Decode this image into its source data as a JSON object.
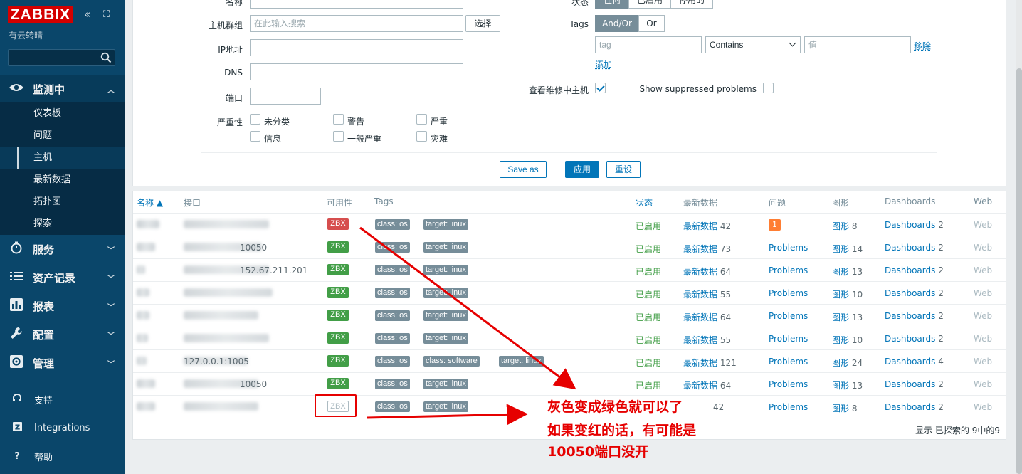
{
  "sidebar": {
    "logo": "ZABBIX",
    "collapse_icon": "«",
    "expand_icon": "⛶",
    "server_name": "有云转晴",
    "menu": [
      {
        "label": "监测中",
        "icon": "eye-icon"
      },
      {
        "label": "服务",
        "icon": "clock-icon"
      },
      {
        "label": "资产记录",
        "icon": "list-icon"
      },
      {
        "label": "报表",
        "icon": "chart-icon"
      },
      {
        "label": "配置",
        "icon": "wrench-icon"
      },
      {
        "label": "管理",
        "icon": "gear-icon"
      }
    ],
    "submenu": [
      "仪表板",
      "问题",
      "主机",
      "最新数据",
      "拓扑图",
      "探索"
    ],
    "bottom": [
      {
        "label": "支持",
        "icon": "headset-icon"
      },
      {
        "label": "Integrations",
        "icon": "integrations-icon"
      },
      {
        "label": "帮助",
        "icon": "help-icon"
      }
    ]
  },
  "filter": {
    "name_label": "名称",
    "group_label": "主机群组",
    "group_placeholder": "在此输入搜索",
    "select_button": "选择",
    "ip_label": "IP地址",
    "dns_label": "DNS",
    "port_label": "端口",
    "severity_label": "严重性",
    "severities": [
      "未分类",
      "警告",
      "严重",
      "信息",
      "一般严重",
      "灾难"
    ],
    "status_label": "状态",
    "status_options": [
      "任何",
      "已启用",
      "停用的"
    ],
    "tags_label": "Tags",
    "tags_and_or": "And/Or",
    "tags_or": "Or",
    "tag_placeholder": "tag",
    "tag_operator": "Contains",
    "tag_value_placeholder": "值",
    "remove_link": "移除",
    "add_link": "添加",
    "maintenance_label": "查看维修中主机",
    "suppressed_label": "Show suppressed problems",
    "save_as": "Save as",
    "apply": "应用",
    "reset": "重设"
  },
  "table": {
    "headers": {
      "name": "名称 ▲",
      "interface": "接口",
      "availability": "可用性",
      "tags": "Tags",
      "status": "状态",
      "latest": "最新数据",
      "problems": "问题",
      "graphs": "图形",
      "dashboards": "Dashboards",
      "web": "Web"
    },
    "rows": [
      {
        "avail": "ZBX",
        "avail_color": "red",
        "tags": [
          "class: os",
          "target: linux"
        ],
        "status": "已启用",
        "latest_label": "最新数据",
        "latest_count": "42",
        "problem": "1",
        "graph_label": "图形",
        "graph_count": "8",
        "dash_label": "Dashboards",
        "dash_count": "2",
        "web": "Web",
        "interface_text": ""
      },
      {
        "avail": "ZBX",
        "avail_color": "green",
        "tags": [
          "class: os",
          "target: linux"
        ],
        "status": "已启用",
        "latest_label": "最新数据",
        "latest_count": "73",
        "problem": "Problems",
        "graph_label": "图形",
        "graph_count": "14",
        "dash_label": "Dashboards",
        "dash_count": "2",
        "web": "Web",
        "interface_text": "10050"
      },
      {
        "avail": "ZBX",
        "avail_color": "green",
        "tags": [
          "class: os",
          "target: linux"
        ],
        "status": "已启用",
        "latest_label": "最新数据",
        "latest_count": "64",
        "problem": "Problems",
        "graph_label": "图形",
        "graph_count": "13",
        "dash_label": "Dashboards",
        "dash_count": "2",
        "web": "Web",
        "interface_text": "152.67.211.201"
      },
      {
        "avail": "ZBX",
        "avail_color": "green",
        "tags": [
          "class: os",
          "target: linux"
        ],
        "status": "已启用",
        "latest_label": "最新数据",
        "latest_count": "55",
        "problem": "Problems",
        "graph_label": "图形",
        "graph_count": "10",
        "dash_label": "Dashboards",
        "dash_count": "2",
        "web": "Web",
        "interface_text": ""
      },
      {
        "avail": "ZBX",
        "avail_color": "green",
        "tags": [
          "class: os",
          "target: linux"
        ],
        "status": "已启用",
        "latest_label": "最新数据",
        "latest_count": "64",
        "problem": "Problems",
        "graph_label": "图形",
        "graph_count": "13",
        "dash_label": "Dashboards",
        "dash_count": "2",
        "web": "Web",
        "interface_text": ""
      },
      {
        "avail": "ZBX",
        "avail_color": "green",
        "tags": [
          "class: os",
          "target: linux"
        ],
        "status": "已启用",
        "latest_label": "最新数据",
        "latest_count": "55",
        "problem": "Problems",
        "graph_label": "图形",
        "graph_count": "10",
        "dash_label": "Dashboards",
        "dash_count": "2",
        "web": "Web",
        "interface_text": ""
      },
      {
        "avail": "ZBX",
        "avail_color": "green",
        "tags": [
          "class: os",
          "class: software",
          "target: linux"
        ],
        "status": "已启用",
        "latest_label": "最新数据",
        "latest_count": "121",
        "problem": "Problems",
        "graph_label": "图形",
        "graph_count": "24",
        "dash_label": "Dashboards",
        "dash_count": "4",
        "web": "Web",
        "interface_text": "127.0.0.1:1005"
      },
      {
        "avail": "ZBX",
        "avail_color": "green",
        "tags": [
          "class: os",
          "target: linux"
        ],
        "status": "已启用",
        "latest_label": "最新数据",
        "latest_count": "64",
        "problem": "Problems",
        "graph_label": "图形",
        "graph_count": "13",
        "dash_label": "Dashboards",
        "dash_count": "2",
        "web": "Web",
        "interface_text": "10050"
      },
      {
        "avail": "ZBX",
        "avail_color": "grey",
        "tags": [
          "class: os",
          "target: linux"
        ],
        "status": "",
        "latest_label": "",
        "latest_count": "42",
        "problem": "Problems",
        "graph_label": "图形",
        "graph_count": "8",
        "dash_label": "Dashboards",
        "dash_count": "2",
        "web": "Web",
        "interface_text": ""
      }
    ],
    "footer": "显示 已探索的 9中的9"
  },
  "annotation": {
    "line1": "灰色变成绿色就可以了",
    "line2": "如果变红的话，有可能是",
    "line3": "10050端口没开",
    "color": "#e60000"
  }
}
